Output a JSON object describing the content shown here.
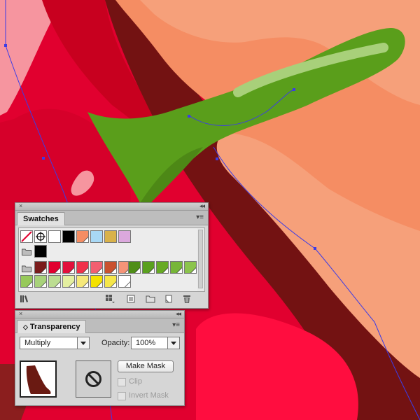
{
  "colors": {
    "red": "#e1002f",
    "deep_red": "#c8001f",
    "maroon": "#731212",
    "pink": "#f25f70",
    "salmon": "#f58d63",
    "light_salmon": "#f6a07a",
    "green": "#5a9e1b",
    "dark_green": "#4d8816",
    "highlight": "#a8d07a",
    "path_blue": "#3c3ce6"
  },
  "swatches_panel": {
    "tab_label": "Swatches",
    "close_glyph": "×",
    "collapse_glyph": "◂◂",
    "menu_glyph": "▾≡",
    "row1": [
      "none",
      "registration",
      "#ffffff",
      "#000000",
      "#f58d63",
      "#a8d8f5",
      "#d9b24a",
      "#dba8dd"
    ],
    "row2": [
      "#000000"
    ],
    "row3": [
      "#7a1c1c",
      "#e1002f",
      "#e20f3b",
      "#f0304a",
      "#f25f70",
      "#c9512f",
      "#f59478",
      "#4f8e18",
      "#5aa01e",
      "#67aa24",
      "#77b638",
      "#8cc44c"
    ],
    "row4": [
      "#97c95a",
      "#a8d27a",
      "#bcdd92",
      "#e4efa0",
      "#f5e87a",
      "#f4e200",
      "#f5e64a",
      "#ffffff"
    ],
    "bottom_icons": [
      "library-icon",
      "kind-icon",
      "options-icon",
      "folder-icon",
      "new-icon",
      "delete-icon"
    ]
  },
  "transparency_panel": {
    "tab_label": "Transparency",
    "close_glyph": "×",
    "collapse_glyph": "◂◂",
    "tab_arrows": "◇",
    "menu_glyph": "▾≡",
    "blend_mode": "Multiply",
    "opacity_label": "Opacity:",
    "opacity_value": "100%",
    "make_mask_label": "Make Mask",
    "clip_label": "Clip",
    "invert_mask_label": "Invert Mask"
  }
}
